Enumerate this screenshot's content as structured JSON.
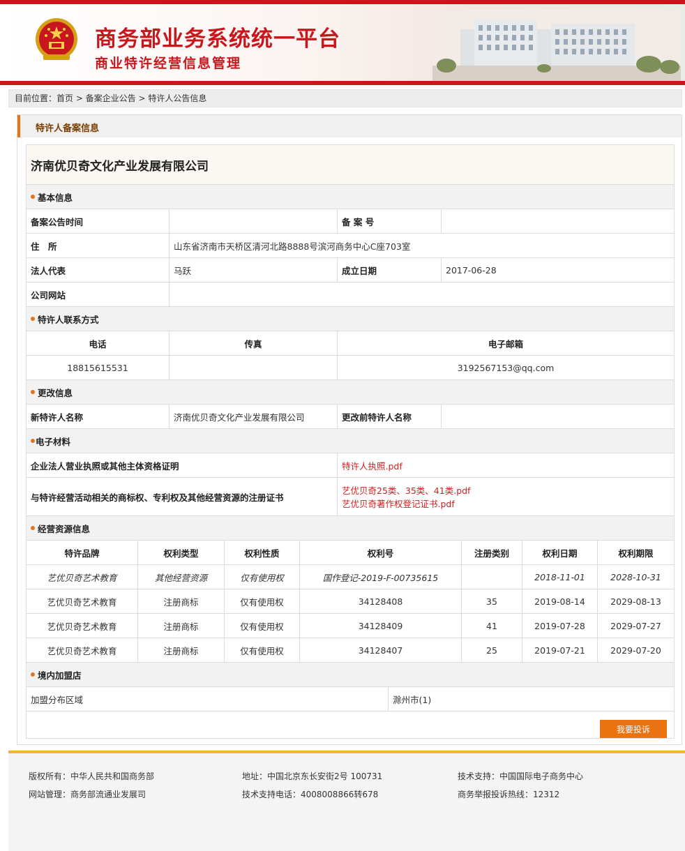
{
  "header": {
    "title": "商务部业务系统统一平台",
    "subtitle": "商业特许经营信息管理"
  },
  "breadcrumb": {
    "prefix": "目前位置：",
    "home": "首页",
    "sep1": " > ",
    "level1": "备案企业公告",
    "sep2": " > ",
    "level2": "特许人公告信息"
  },
  "panel": {
    "title": "特许人备案信息"
  },
  "company": {
    "name": "济南优贝奇文化产业发展有限公司"
  },
  "basic": {
    "section_title": "基本信息",
    "announce_time_label": "备案公告时间",
    "announce_time_value": "",
    "record_no_label": "备 案 号",
    "record_no_value": "",
    "address_label": "住　所",
    "address_value": "山东省济南市天桥区清河北路8888号滨河商务中心C座703室",
    "legal_rep_label": "法人代表",
    "legal_rep_value": "马跃",
    "founded_label": "成立日期",
    "founded_value": "2017-06-28",
    "website_label": "公司网站",
    "website_value": ""
  },
  "contact": {
    "section_title": "特许人联系方式",
    "headers": [
      "电话",
      "传真",
      "电子邮箱"
    ],
    "phone": "18815615531",
    "fax": "",
    "email": "3192567153@qq.com"
  },
  "change": {
    "section_title": "更改信息",
    "new_name_label": "新特许人名称",
    "new_name_value": "济南优贝奇文化产业发展有限公司",
    "old_name_label": "更改前特许人名称",
    "old_name_value": ""
  },
  "materials": {
    "section_title": "电子材料",
    "license_label": "企业法人营业执照或其他主体资格证明",
    "license_file": "特许人执照.pdf",
    "cert_label": "与特许经营活动相关的商标权、专利权及其他经营资源的注册证书",
    "cert_files": [
      "艺优贝奇25类、35类、41类.pdf",
      "艺优贝奇著作权登记证书.pdf"
    ]
  },
  "resources": {
    "section_title": "经营资源信息",
    "headers": [
      "特许品牌",
      "权利类型",
      "权利性质",
      "权利号",
      "注册类别",
      "权利日期",
      "权利期限"
    ],
    "rows": [
      [
        "艺优贝奇艺术教育",
        "其他经营资源",
        "仅有使用权",
        "国作登记-2019-F-00735615",
        "",
        "2018-11-01",
        "2028-10-31"
      ],
      [
        "艺优贝奇艺术教育",
        "注册商标",
        "仅有使用权",
        "34128408",
        "35",
        "2019-08-14",
        "2029-08-13"
      ],
      [
        "艺优贝奇艺术教育",
        "注册商标",
        "仅有使用权",
        "34128409",
        "41",
        "2019-07-28",
        "2029-07-27"
      ],
      [
        "艺优贝奇艺术教育",
        "注册商标",
        "仅有使用权",
        "34128407",
        "25",
        "2019-07-21",
        "2029-07-20"
      ]
    ]
  },
  "stores": {
    "section_title": "境内加盟店",
    "area_label": "加盟分布区域",
    "area_value": "滁州市(1)"
  },
  "complain_button": "我要投诉",
  "footer": {
    "copyright": "版权所有：中华人民共和国商务部",
    "address": "地址：中国北京东长安街2号 100731",
    "support": "技术支持：中国国际电子商务中心",
    "manage": "网站管理：商务部流通业发展司",
    "support_phone": "技术支持电话：4008008866转678",
    "hotline": "商务举报投诉热线：12312"
  },
  "colors": {
    "brand_red": "#c8161d",
    "accent_orange": "#e0761b",
    "link_red": "#d01c1c",
    "footer_rule": "#f4b33d"
  }
}
